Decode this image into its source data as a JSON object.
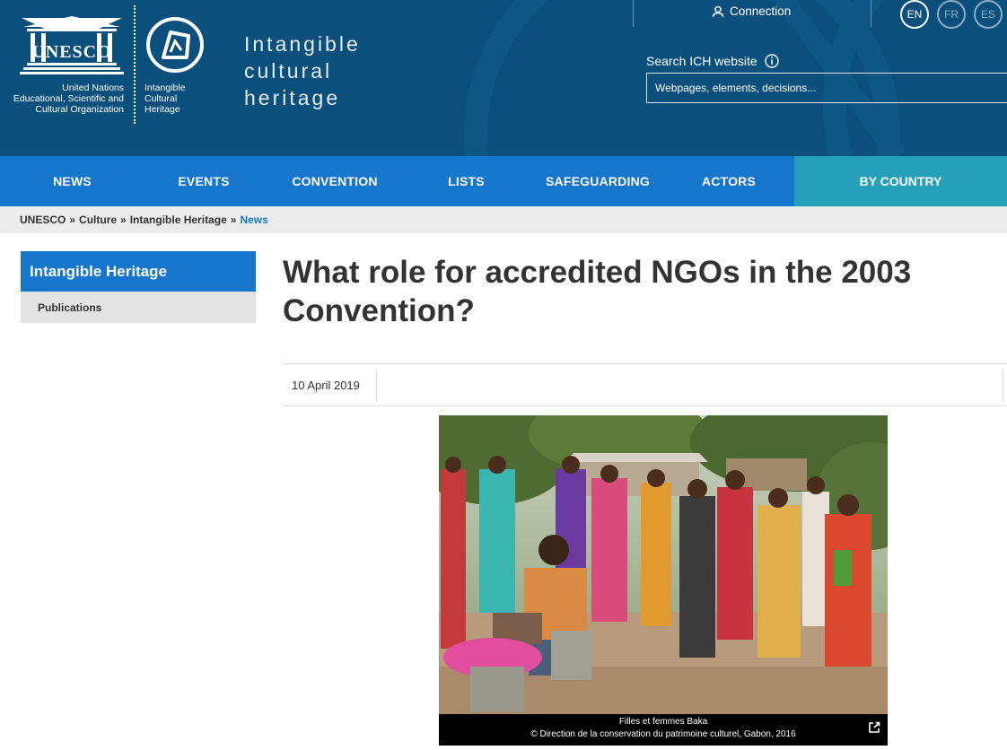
{
  "header": {
    "unesco_wordmark": "UNESCO",
    "unesco_subtitle": [
      "United Nations",
      "Educational, Scientific and",
      "Cultural Organization"
    ],
    "ich_subtitle": [
      "Intangible",
      "Cultural",
      "Heritage"
    ],
    "site_title": [
      "Intangible",
      "cultural",
      "heritage"
    ],
    "connection_label": "Connection",
    "languages": [
      {
        "code": "EN",
        "active": true
      },
      {
        "code": "FR",
        "active": false
      },
      {
        "code": "ES",
        "active": false
      }
    ],
    "search_label": "Search ICH website",
    "search_placeholder": "Webpages, elements, decisions...",
    "colors": {
      "background": "#0b4f7c",
      "text": "#ffffff"
    }
  },
  "nav": {
    "items": [
      "NEWS",
      "EVENTS",
      "CONVENTION",
      "LISTS",
      "SAFEGUARDING",
      "ACTORS"
    ],
    "by_country": "BY COUNTRY",
    "colors": {
      "primary": "#1676cc",
      "country": "#26a0b8"
    }
  },
  "breadcrumb": {
    "items": [
      "UNESCO",
      "Culture",
      "Intangible Heritage"
    ],
    "separator": "»",
    "current": "News"
  },
  "sidebar": {
    "title": "Intangible Heritage",
    "items": [
      "Publications"
    ]
  },
  "article": {
    "title": "What role for accredited NGOs in the 2003 Convention?",
    "date": "10 April 2019",
    "photo_caption_title": "Filles et femmes Baka",
    "photo_caption_credit": "© Direction de la conservation du patrimoine culturel, Gabon, 2016"
  }
}
